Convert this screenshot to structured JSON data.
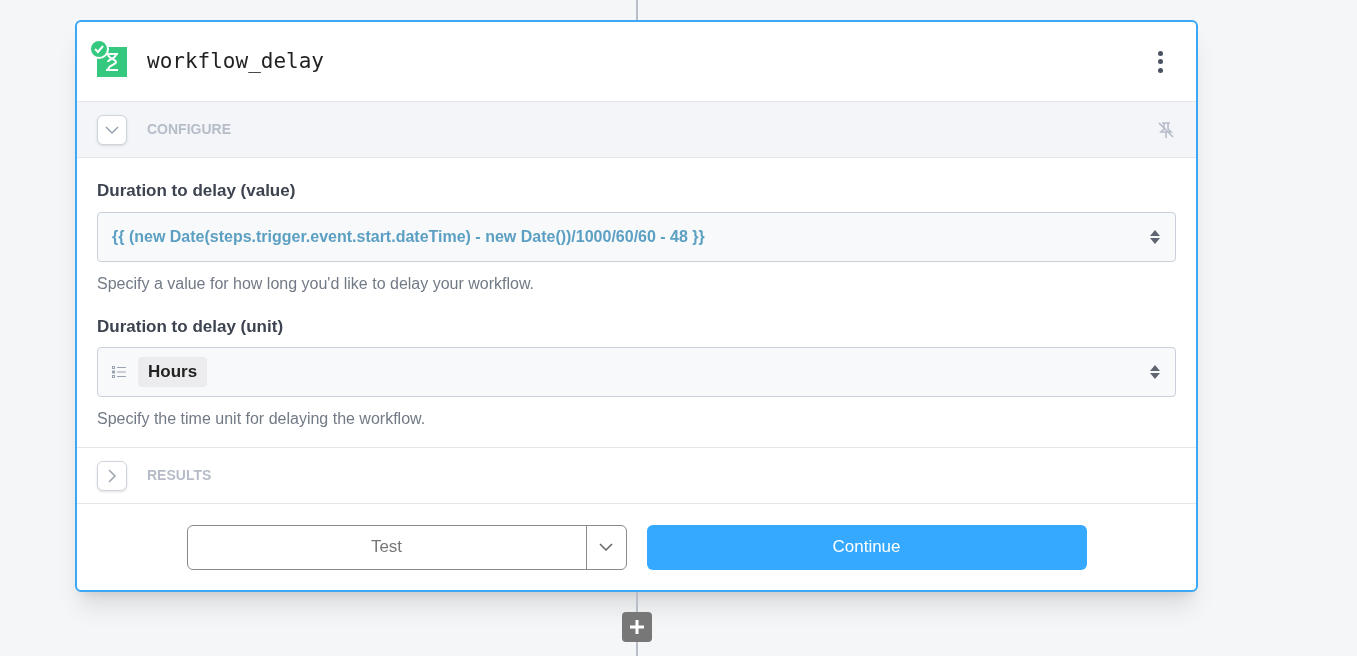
{
  "step": {
    "title": "workflow_delay",
    "status_ok": true
  },
  "sections": [
    {
      "kind": "configure",
      "label": "CONFIGURE",
      "expanded": true
    },
    {
      "kind": "results",
      "label": "RESULTS",
      "expanded": false
    }
  ],
  "fields": [
    {
      "kind": "expression",
      "label": "Duration to delay (value)",
      "value": "{{ (new Date(steps.trigger.event.start.dateTime) - new Date())/1000/60/60 - 48 }}",
      "help": "Specify a value for how long you'd like to delay your workflow."
    },
    {
      "kind": "select",
      "label": "Duration to delay (unit)",
      "value": "Hours",
      "help": "Specify the time unit for delaying the workflow."
    }
  ],
  "buttons": {
    "test": "Test",
    "continue": "Continue"
  }
}
